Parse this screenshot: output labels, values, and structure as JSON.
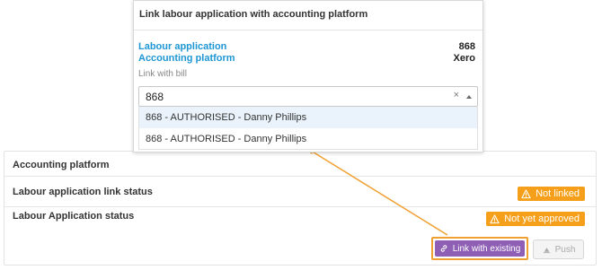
{
  "dialog": {
    "title": "Link labour application with accounting platform",
    "labour_application_label": "Labour application",
    "labour_application_value": "868",
    "accounting_platform_label": "Accounting platform",
    "accounting_platform_value": "Xero",
    "link_with_bill_label": "Link with bill",
    "search_value": "868",
    "clear_symbol": "×",
    "options": [
      "868 - AUTHORISED - Danny Phillips",
      "868 - AUTHORISED - Danny Phillips"
    ]
  },
  "panel": {
    "accounting_platform_label": "Accounting platform",
    "link_status_label": "Labour application link status",
    "link_status_badge": "Not linked",
    "app_status_label": "Labour Application status",
    "app_status_badge": "Not yet approved",
    "link_existing_button": "Link with existing",
    "push_button": "Push"
  },
  "colors": {
    "accent_purple": "#8e5fb4",
    "warning_orange": "#f59f1a",
    "link_blue": "#1e96d4",
    "highlight_orange": "#f0a030"
  }
}
